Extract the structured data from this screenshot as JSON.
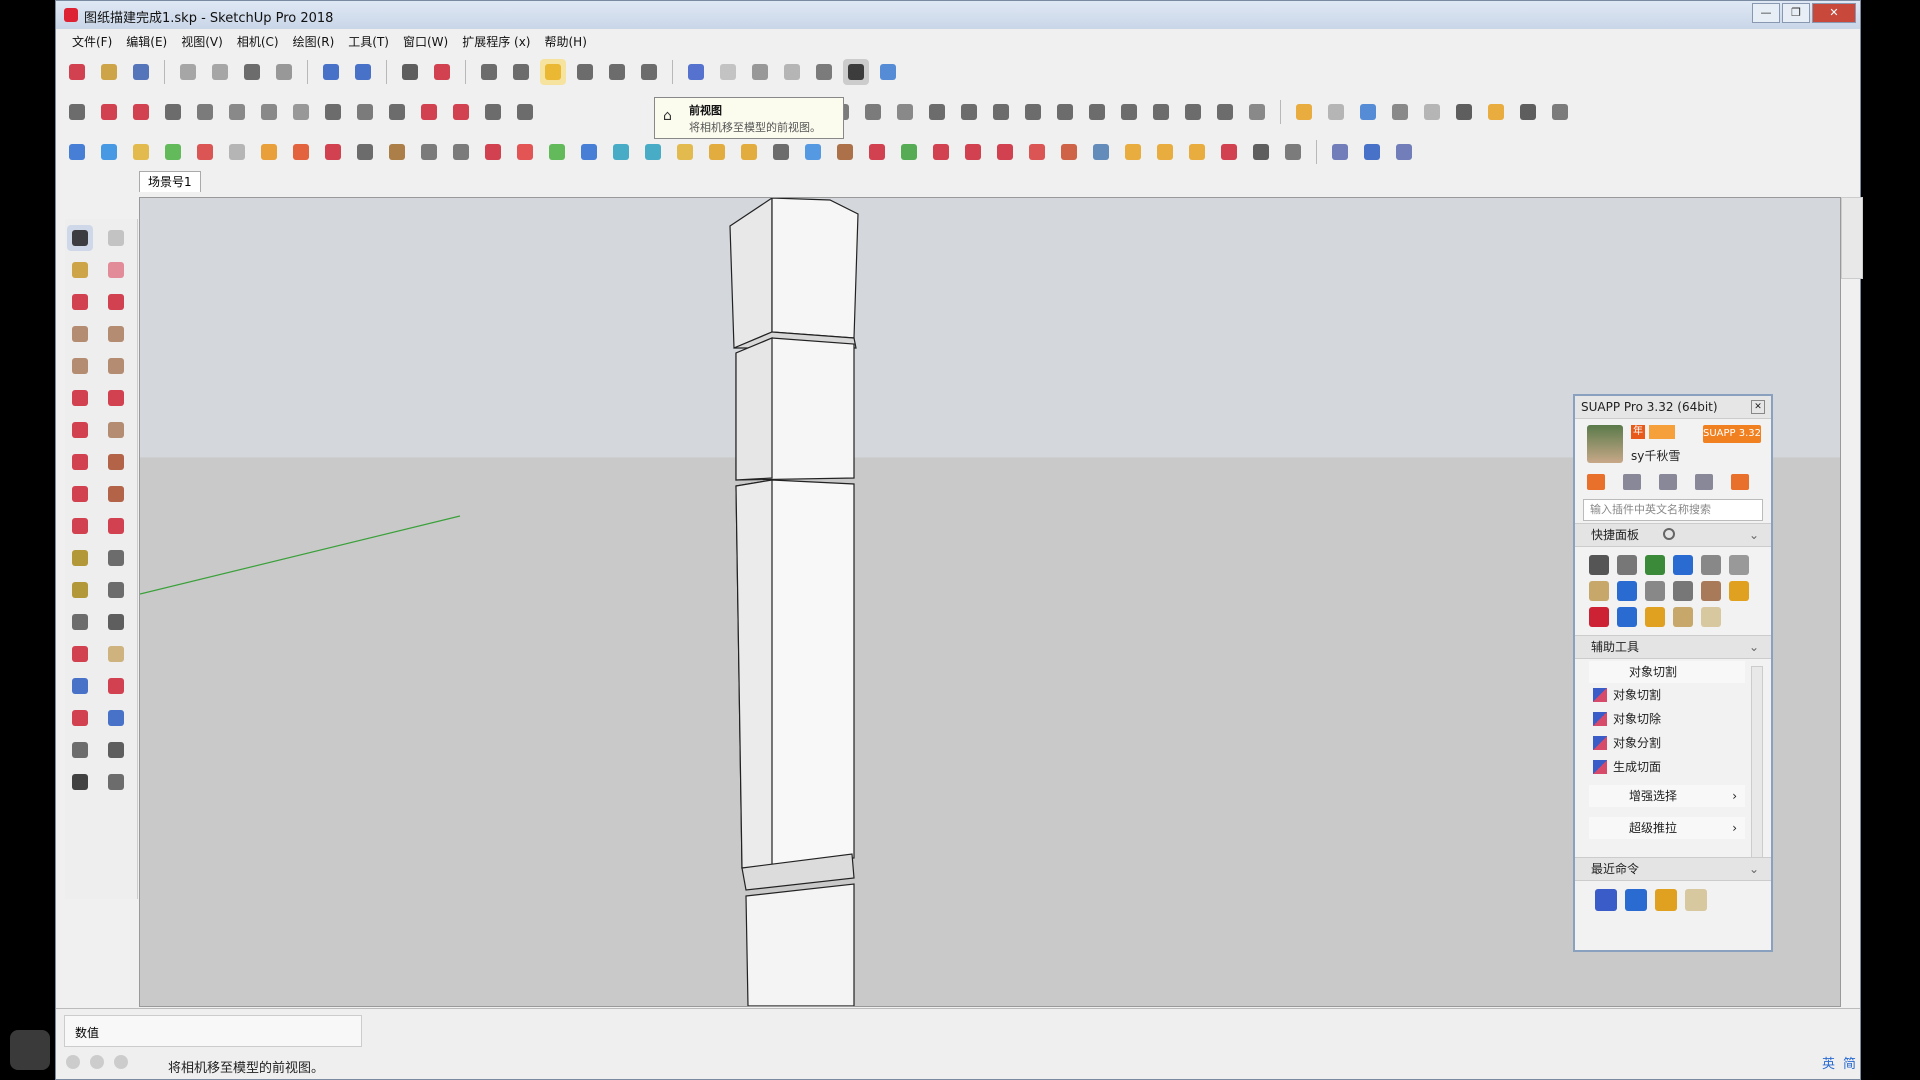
{
  "window": {
    "title": "图纸描建完成1.skp - SketchUp Pro 2018",
    "controls": [
      "—",
      "❐",
      "✕"
    ]
  },
  "menu": [
    "文件(F)",
    "编辑(E)",
    "视图(V)",
    "相机(C)",
    "绘图(R)",
    "工具(T)",
    "窗口(W)",
    "扩展程序 (x)",
    "帮助(H)"
  ],
  "tooltip": {
    "title": "前视图",
    "description": "将相机移至模型的前视图。"
  },
  "scene_tab": "场景号1",
  "vcb_label": "数值",
  "status_text": "将相机移至模型的前视图。",
  "tray": [
    "英",
    "简"
  ],
  "suapp": {
    "title": "SUAPP Pro 3.32 (64bit)",
    "username": "sy千秋雪",
    "badge": "年",
    "version_button": "SUAPP 3.32",
    "search_placeholder": "输入插件中英文名称搜索",
    "quick_panel": "快捷面板",
    "aux_tools": "辅助工具",
    "submenu": "对象切割",
    "items": [
      "对象切割",
      "对象切除",
      "对象分割",
      "生成切面"
    ],
    "enhance_select": "增强选择",
    "super_pushpull": "超级推拉",
    "recent": "最近命令"
  },
  "colors": {
    "accent": "#2a6bd1",
    "suapp_orange": "#f08020",
    "axis_green": "#3aa03a"
  },
  "icons": {
    "toolbar1": [
      "new-icon",
      "open-icon",
      "save-icon",
      "cut-icon",
      "copy-icon",
      "paste-icon",
      "erase-icon",
      "undo-icon",
      "redo-icon",
      "print-icon",
      "model-info-icon",
      "iso-icon",
      "top-icon",
      "front-view-icon",
      "right-icon",
      "back-icon",
      "left-icon",
      "xray-icon",
      "wireframe-icon",
      "hidden-line-icon",
      "shaded-icon",
      "textured-icon",
      "monochrome-icon"
    ]
  }
}
